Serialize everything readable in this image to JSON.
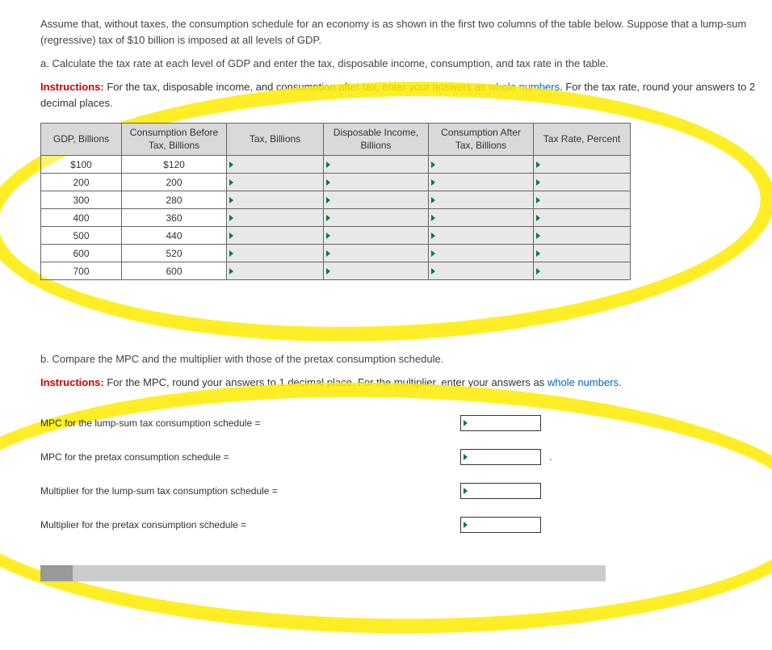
{
  "intro": {
    "p1": "Assume that, without taxes, the consumption schedule for an economy is as shown in the first two columns of the table below. Suppose that a lump-sum (regressive) tax of $10 billion is imposed at all levels of GDP.",
    "a": "a. Calculate the tax rate at each level of GDP and enter the tax, disposable income, consumption, and tax rate in the table.",
    "instr_label": "Instructions:",
    "instr_text_1": " For the tax, disposable income, and consumption after tax, enter your answers as ",
    "instr_whole": "whole numbers",
    "instr_text_2": ". For the tax rate, round your answers to 2 decimal places."
  },
  "table": {
    "headers": {
      "gdp": "GDP, Billions",
      "cons_before": "Consumption Before Tax, Billions",
      "tax": "Tax, Billions",
      "disp": "Disposable Income, Billions",
      "cons_after": "Consumption After Tax, Billions",
      "rate": "Tax Rate, Percent"
    },
    "rows": [
      {
        "gdp": "$100",
        "cons_before": "$120"
      },
      {
        "gdp": "200",
        "cons_before": "200"
      },
      {
        "gdp": "300",
        "cons_before": "280"
      },
      {
        "gdp": "400",
        "cons_before": "360"
      },
      {
        "gdp": "500",
        "cons_before": "440"
      },
      {
        "gdp": "600",
        "cons_before": "520"
      },
      {
        "gdp": "700",
        "cons_before": "600"
      }
    ]
  },
  "partb": {
    "text": "b. Compare the MPC and the multiplier with those of the pretax consumption schedule.",
    "instr_label": "Instructions:",
    "instr_text_1": " For the MPC, round your answers to 1 decimal place. For the multiplier, enter your answers as ",
    "instr_whole": "whole numbers",
    "instr_text_2": "."
  },
  "answers": {
    "r1": "MPC for the lump-sum tax consumption schedule =",
    "r2": "MPC for the pretax consumption schedule =",
    "r3": "Multiplier for the lump-sum tax consumption schedule =",
    "r4": "Multiplier for the pretax consumption schedule ="
  }
}
